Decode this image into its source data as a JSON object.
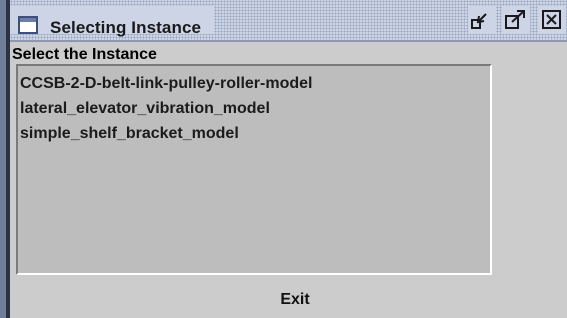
{
  "window": {
    "title": "Selecting Instance",
    "title_icon": "window-icon",
    "buttons": {
      "minimize_icon": "minimize-icon",
      "maximize_icon": "maximize-icon",
      "close_icon": "close-icon"
    },
    "colors": {
      "titlebar": "#ccd4e6",
      "body": "#cccccc",
      "list_background": "#bdbdbd",
      "left_edge": "#6f7f9a"
    }
  },
  "instance_panel": {
    "label": "Select the Instance",
    "items": [
      "CCSB-2-D-belt-link-pulley-roller-model",
      "lateral_elevator_vibration_model",
      "simple_shelf_bracket_model"
    ]
  },
  "footer": {
    "exit_label": "Exit"
  }
}
